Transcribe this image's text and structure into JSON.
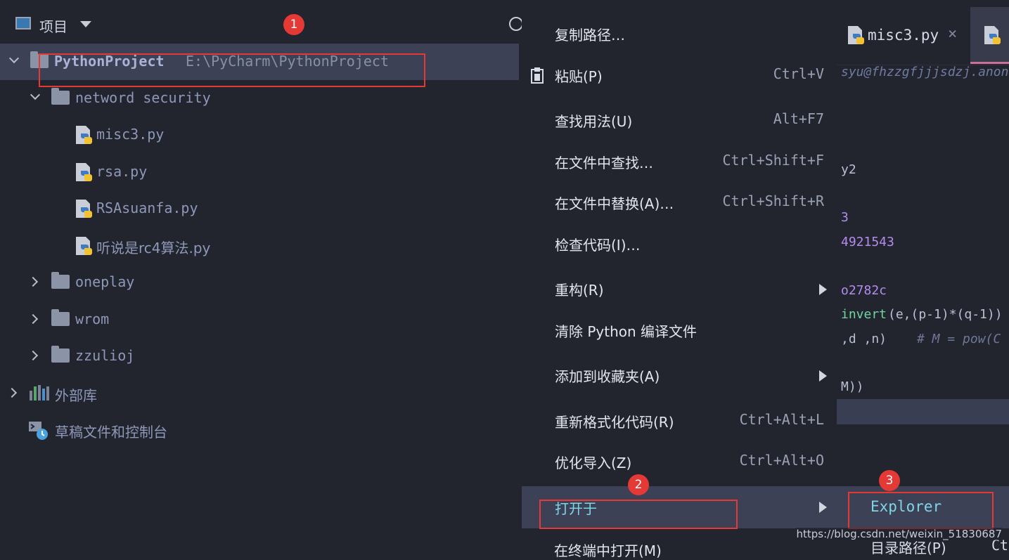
{
  "project_panel": {
    "title": "项目",
    "root": {
      "name": "PythonProject",
      "path": "E:\\PyCharm\\PythonProject"
    },
    "folders": [
      {
        "name": "netword security",
        "expanded": true,
        "files": [
          "misc3.py",
          "rsa.py",
          "RSAsuanfa.py",
          "听说是rc4算法.py"
        ]
      },
      {
        "name": "oneplay",
        "expanded": false
      },
      {
        "name": "wrom",
        "expanded": false
      },
      {
        "name": "zzulioj",
        "expanded": false
      }
    ],
    "external_libraries": "外部库",
    "scratches": "草稿文件和控制台"
  },
  "editor": {
    "tabs": [
      {
        "label": "misc3.py",
        "active": false
      }
    ],
    "code": {
      "author_fragment": "syu@fhzzgfjjjsdzj.anon",
      "line_y2": "y2",
      "line_3": "3",
      "line_num": "4921543",
      "line_hex": "o2782c",
      "line_invert_fn": "invert",
      "line_invert_args": "(e,(p-1)*(q-1))",
      "line_args": ",d ,n)",
      "line_comment": "# M = pow(C",
      "line_m": "M))"
    }
  },
  "context_menu": {
    "items": [
      {
        "label": "复制路径…",
        "shortcut": ""
      },
      {
        "label": "粘贴(P)",
        "shortcut": "Ctrl+V"
      },
      {
        "label": "查找用法(U)",
        "shortcut": "Alt+F7"
      },
      {
        "label": "在文件中查找…",
        "shortcut": "Ctrl+Shift+F"
      },
      {
        "label": "在文件中替换(A)…",
        "shortcut": "Ctrl+Shift+R"
      },
      {
        "label": "检查代码(I)…",
        "shortcut": ""
      },
      {
        "label": "重构(R)",
        "shortcut": ""
      },
      {
        "label": "清除 Python 编译文件",
        "shortcut": ""
      },
      {
        "label": "添加到收藏夹(A)",
        "shortcut": ""
      },
      {
        "label": "重新格式化代码(R)",
        "shortcut": "Ctrl+Alt+L"
      },
      {
        "label": "优化导入(Z)",
        "shortcut": "Ctrl+Alt+O"
      },
      {
        "label": "打开于",
        "shortcut": ""
      }
    ],
    "bottom_cut_label": "在终端中打开(M)"
  },
  "submenu": {
    "explorer": "Explorer",
    "next_label": "目录路径(P)",
    "next_shortcut": "Ct"
  },
  "annotations": {
    "badge1": "1",
    "badge2": "2",
    "badge3": "3"
  },
  "watermark": "https://blog.csdn.net/weixin_51830687",
  "colors": {
    "annotation_red": "#e53935",
    "selection": "#3d4155",
    "highlight_text": "#7fd6e8"
  }
}
